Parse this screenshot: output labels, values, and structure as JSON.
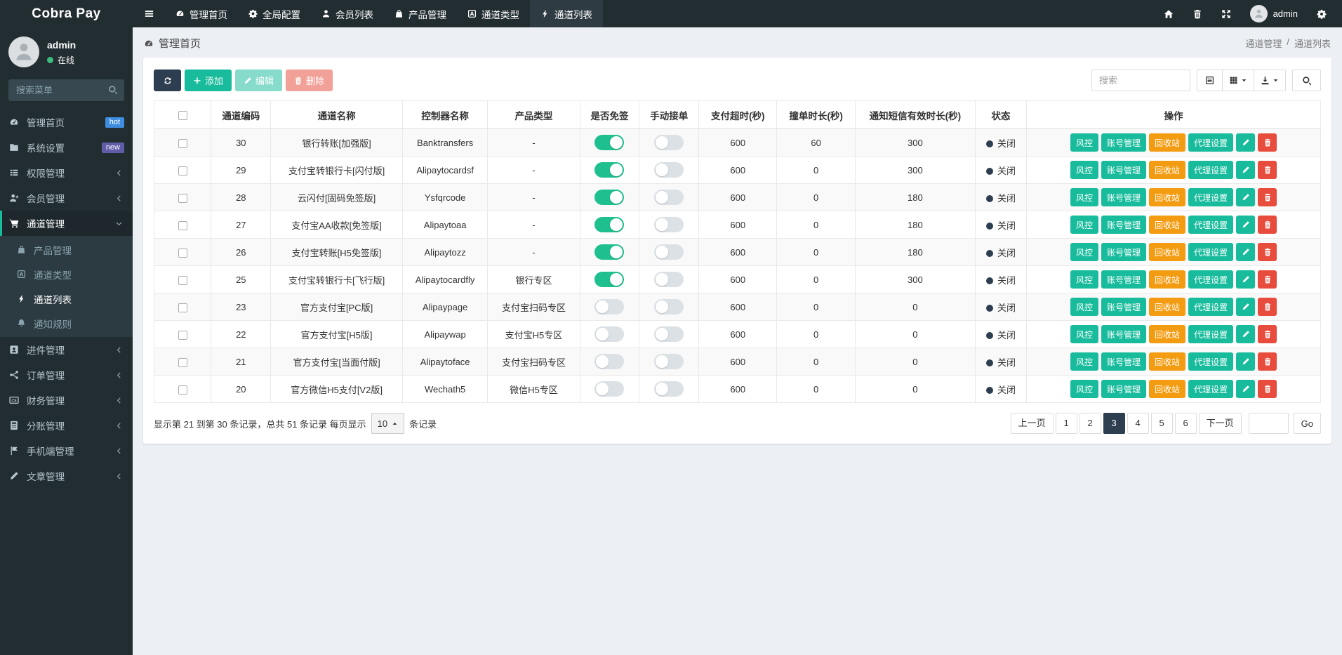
{
  "brand": "Cobra Pay",
  "topnav": {
    "items": [
      {
        "label": "管理首页",
        "icon": "gauge"
      },
      {
        "label": "全局配置",
        "icon": "gear"
      },
      {
        "label": "会员列表",
        "icon": "person"
      },
      {
        "label": "产品管理",
        "icon": "bag"
      },
      {
        "label": "通道类型",
        "icon": "square-a"
      },
      {
        "label": "通道列表",
        "icon": "bolt",
        "active": true
      }
    ],
    "user": "admin"
  },
  "sidebar": {
    "user": {
      "name": "admin",
      "status": "在线"
    },
    "search_placeholder": "搜索菜单",
    "items": [
      {
        "label": "管理首页",
        "icon": "gauge",
        "badge": "hot",
        "badge_color": "#3d8ee0"
      },
      {
        "label": "系统设置",
        "icon": "folder",
        "badge": "new",
        "badge_color": "#605ca8"
      },
      {
        "label": "权限管理",
        "icon": "list",
        "chevron": true
      },
      {
        "label": "会员管理",
        "icon": "person-plus",
        "chevron": true
      },
      {
        "label": "通道管理",
        "icon": "cart",
        "active": true,
        "children": [
          {
            "label": "产品管理",
            "icon": "bag"
          },
          {
            "label": "通道类型",
            "icon": "square-a"
          },
          {
            "label": "通道列表",
            "icon": "bolt",
            "active": true
          },
          {
            "label": "通知规则",
            "icon": "bell"
          }
        ]
      },
      {
        "label": "进件管理",
        "icon": "id",
        "chevron": true
      },
      {
        "label": "订单管理",
        "icon": "share",
        "chevron": true
      },
      {
        "label": "财务管理",
        "icon": "cs-card",
        "chevron": true
      },
      {
        "label": "分账管理",
        "icon": "calc",
        "chevron": true
      },
      {
        "label": "手机端管理",
        "icon": "flag",
        "chevron": true
      },
      {
        "label": "文章管理",
        "icon": "pencil",
        "chevron": true
      }
    ]
  },
  "content": {
    "page_title": "管理首页",
    "breadcrumb": [
      "通道管理",
      "通道列表"
    ],
    "breadcrumb_sep": "/",
    "toolbar": {
      "add_label": "添加",
      "edit_label": "编辑",
      "delete_label": "删除",
      "search_placeholder": "搜索"
    },
    "table": {
      "columns": [
        "通道编码",
        "通道名称",
        "控制器名称",
        "产品类型",
        "是否免签",
        "手动接单",
        "支付超时(秒)",
        "撞单时长(秒)",
        "通知短信有效时长(秒)",
        "状态",
        "操作"
      ],
      "action_labels": [
        "风控",
        "账号管理",
        "回收站",
        "代理设置"
      ],
      "rows": [
        {
          "code": 30,
          "name": "银行转账[加强版]",
          "controller": "Banktransfers",
          "ptype": "-",
          "nosign": true,
          "manual": false,
          "timeout": 600,
          "collide": 60,
          "sms": 300,
          "status": "关闭"
        },
        {
          "code": 29,
          "name": "支付宝转银行卡[闪付版]",
          "controller": "Alipaytocardsf",
          "ptype": "-",
          "nosign": true,
          "manual": false,
          "timeout": 600,
          "collide": 0,
          "sms": 300,
          "status": "关闭"
        },
        {
          "code": 28,
          "name": "云闪付[固码免签版]",
          "controller": "Ysfqrcode",
          "ptype": "-",
          "nosign": true,
          "manual": false,
          "timeout": 600,
          "collide": 0,
          "sms": 180,
          "status": "关闭"
        },
        {
          "code": 27,
          "name": "支付宝AA收款[免签版]",
          "controller": "Alipaytoaa",
          "ptype": "-",
          "nosign": true,
          "manual": false,
          "timeout": 600,
          "collide": 0,
          "sms": 180,
          "status": "关闭"
        },
        {
          "code": 26,
          "name": "支付宝转账[H5免签版]",
          "controller": "Alipaytozz",
          "ptype": "-",
          "nosign": true,
          "manual": false,
          "timeout": 600,
          "collide": 0,
          "sms": 180,
          "status": "关闭"
        },
        {
          "code": 25,
          "name": "支付宝转银行卡[飞行版]",
          "controller": "Alipaytocardfly",
          "ptype": "银行专区",
          "nosign": true,
          "manual": false,
          "timeout": 600,
          "collide": 0,
          "sms": 300,
          "status": "关闭"
        },
        {
          "code": 23,
          "name": "官方支付宝[PC版]",
          "controller": "Alipaypage",
          "ptype": "支付宝扫码专区",
          "nosign": false,
          "manual": false,
          "timeout": 600,
          "collide": 0,
          "sms": 0,
          "status": "关闭"
        },
        {
          "code": 22,
          "name": "官方支付宝[H5版]",
          "controller": "Alipaywap",
          "ptype": "支付宝H5专区",
          "nosign": false,
          "manual": false,
          "timeout": 600,
          "collide": 0,
          "sms": 0,
          "status": "关闭"
        },
        {
          "code": 21,
          "name": "官方支付宝[当面付版]",
          "controller": "Alipaytoface",
          "ptype": "支付宝扫码专区",
          "nosign": false,
          "manual": false,
          "timeout": 600,
          "collide": 0,
          "sms": 0,
          "status": "关闭"
        },
        {
          "code": 20,
          "name": "官方微信H5支付[V2版]",
          "controller": "Wechath5",
          "ptype": "微信H5专区",
          "nosign": false,
          "manual": false,
          "timeout": 600,
          "collide": 0,
          "sms": 0,
          "status": "关闭"
        }
      ]
    },
    "footer": {
      "summary_prefix": "显示第 21 到第 30 条记录，总共 51 条记录 每页显示",
      "page_size": "10",
      "summary_suffix": "条记录",
      "pages": [
        {
          "label": "上一页"
        },
        {
          "label": "1"
        },
        {
          "label": "2"
        },
        {
          "label": "3",
          "active": true
        },
        {
          "label": "4"
        },
        {
          "label": "5"
        },
        {
          "label": "6"
        },
        {
          "label": "下一页"
        }
      ],
      "go_label": "Go"
    }
  },
  "colors": {
    "dark": "#222d32",
    "darker": "#1e282c",
    "submenu": "#2c3b41",
    "green": "#18bc9c",
    "toggle-green": "#1fc08f",
    "toggle-off": "#dce1e6",
    "orange": "#f39c12",
    "red": "#e74c3c",
    "navy": "#2c3e50",
    "teal": "#1abc9c",
    "bg": "#ecf0f5",
    "online": "#3dbd7d",
    "topnav-active": "#2f3b43"
  }
}
